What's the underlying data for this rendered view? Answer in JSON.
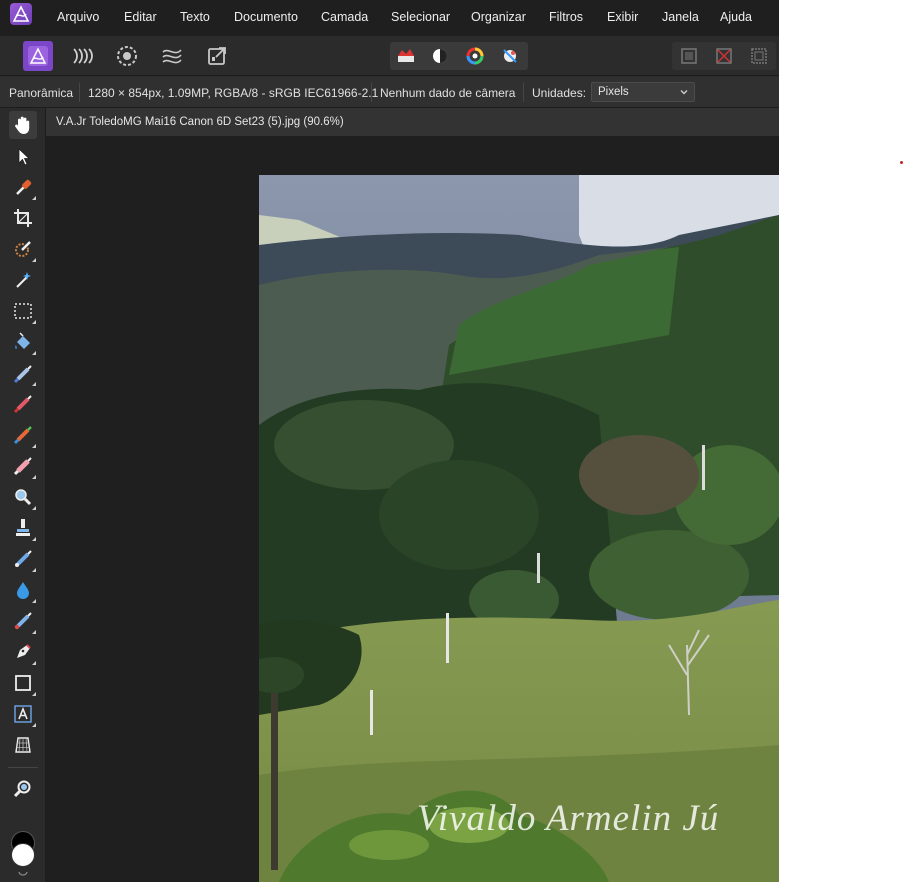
{
  "app": {
    "logo_icon": "affinity-photo-logo-icon"
  },
  "menu": {
    "items": [
      "Arquivo",
      "Editar",
      "Texto",
      "Documento",
      "Camada",
      "Selecionar",
      "Organizar",
      "Filtros",
      "Exibir",
      "Janela",
      "Ajuda"
    ]
  },
  "toolbar": {
    "personas": [
      "photo-persona-icon",
      "liquify-persona-icon",
      "develop-persona-icon",
      "tone-mapping-persona-icon",
      "export-persona-icon"
    ],
    "center_tools": [
      "auto-levels-icon",
      "auto-contrast-icon",
      "auto-colors-icon",
      "auto-white-balance-icon"
    ],
    "right_tools": [
      "snapping-icon",
      "close-grid-icon",
      "assistant-icon"
    ]
  },
  "context": {
    "tool_name": "Panorâmica",
    "doc_info": "1280 × 854px, 1.09MP, RGBA/8 - sRGB IEC61966-2.1",
    "camera": "Nenhum dado de câmera",
    "units_label": "Unidades:",
    "units_value": "Pixels"
  },
  "document": {
    "tab_title": "V.A.Jr ToledoMG Mai16 Canon 6D Set23 (5).jpg (90.6%)",
    "watermark": "Vivaldo Armelin Jú"
  },
  "colors": {
    "accent": "#8a4fd1",
    "menubar_bg": "#1f1f1f",
    "panel_bg": "#2b2b2b",
    "canvas_bg": "#1f1f1f"
  }
}
